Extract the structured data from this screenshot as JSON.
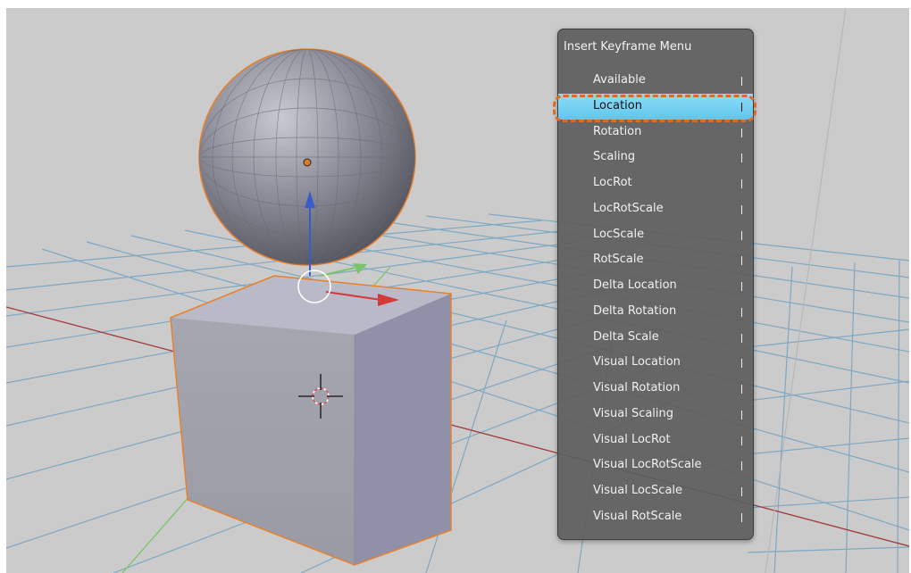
{
  "viewport": {
    "colors": {
      "background": "#cbcbcb",
      "grid": "#7ea8c2",
      "x_axis": "#a23a3a",
      "y_axis": "#7cc46a",
      "selection_outline": "#e8802c",
      "active_menu_item": "#6ccdf1",
      "callout_ring": "#e06a22"
    },
    "objects": [
      "cube",
      "uv-sphere",
      "3d-cursor",
      "translate-manipulator"
    ]
  },
  "menu": {
    "title": "Insert Keyframe Menu",
    "active_index": 1,
    "items": [
      {
        "label": "Available",
        "shortcut_glyph": "I"
      },
      {
        "label": "Location",
        "shortcut_glyph": "I"
      },
      {
        "label": "Rotation",
        "shortcut_glyph": "I"
      },
      {
        "label": "Scaling",
        "shortcut_glyph": "I"
      },
      {
        "label": "LocRot",
        "shortcut_glyph": "I"
      },
      {
        "label": "LocRotScale",
        "shortcut_glyph": "I"
      },
      {
        "label": "LocScale",
        "shortcut_glyph": "I"
      },
      {
        "label": "RotScale",
        "shortcut_glyph": "I"
      },
      {
        "label": "Delta Location",
        "shortcut_glyph": "I"
      },
      {
        "label": "Delta Rotation",
        "shortcut_glyph": "I"
      },
      {
        "label": "Delta Scale",
        "shortcut_glyph": "I"
      },
      {
        "label": "Visual Location",
        "shortcut_glyph": "I"
      },
      {
        "label": "Visual Rotation",
        "shortcut_glyph": "I"
      },
      {
        "label": "Visual Scaling",
        "shortcut_glyph": "I"
      },
      {
        "label": "Visual LocRot",
        "shortcut_glyph": "I"
      },
      {
        "label": "Visual LocRotScale",
        "shortcut_glyph": "I"
      },
      {
        "label": "Visual LocScale",
        "shortcut_glyph": "I"
      },
      {
        "label": "Visual RotScale",
        "shortcut_glyph": "I"
      }
    ]
  }
}
